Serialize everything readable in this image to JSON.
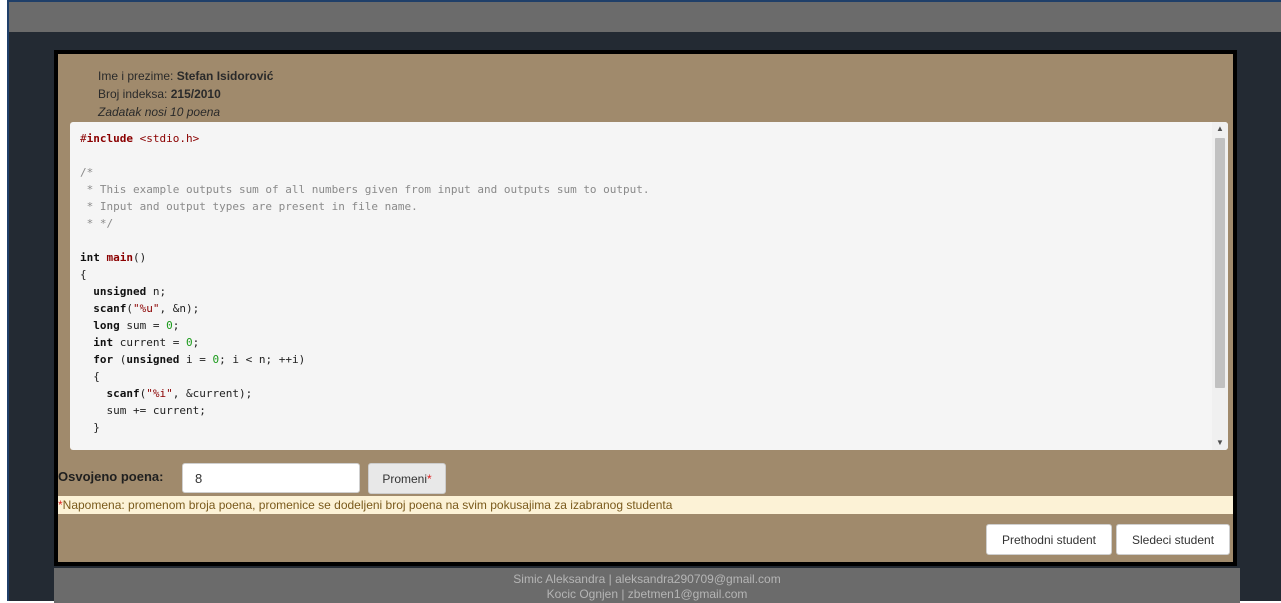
{
  "student": {
    "name_label": "Ime i prezime:",
    "name": "Stefan Isidorović",
    "index_label": "Broj indeksa:",
    "index": "215/2010",
    "task_note": "Zadatak nosi 10 poena"
  },
  "code": {
    "lines": [
      "#include <stdio.h>",
      "",
      "/*",
      " * This example outputs sum of all numbers given from input and outputs sum to output.",
      " * Input and output types are present in file name.",
      " * */",
      "",
      "int main()",
      "{",
      "  unsigned n;",
      "  scanf(\"%u\", &n);",
      "  long sum = 0;",
      "  int current = 0;",
      "  for (unsigned i = 0; i < n; ++i)",
      "  {",
      "    scanf(\"%i\", &current);",
      "    sum += current;",
      "  }"
    ]
  },
  "points": {
    "label": "Osvojeno poena:",
    "value": "8",
    "button_label": "Promeni",
    "button_star": "*"
  },
  "note": {
    "star": "*",
    "text": "Napomena: promenom broja poena, promenice se dodeljeni broj poena na svim pokusajima za izabranog studenta"
  },
  "nav": {
    "prev_label": "Prethodni student",
    "next_label": "Sledeci student"
  },
  "footer": {
    "line1": "Simic Aleksandra | aleksandra290709@gmail.com",
    "line2": "Kocic Ognjen | zbetmen1@gmail.com"
  },
  "icons": {
    "scroll_up": "scroll-up-arrow-icon",
    "scroll_down": "scroll-down-arrow-icon"
  }
}
